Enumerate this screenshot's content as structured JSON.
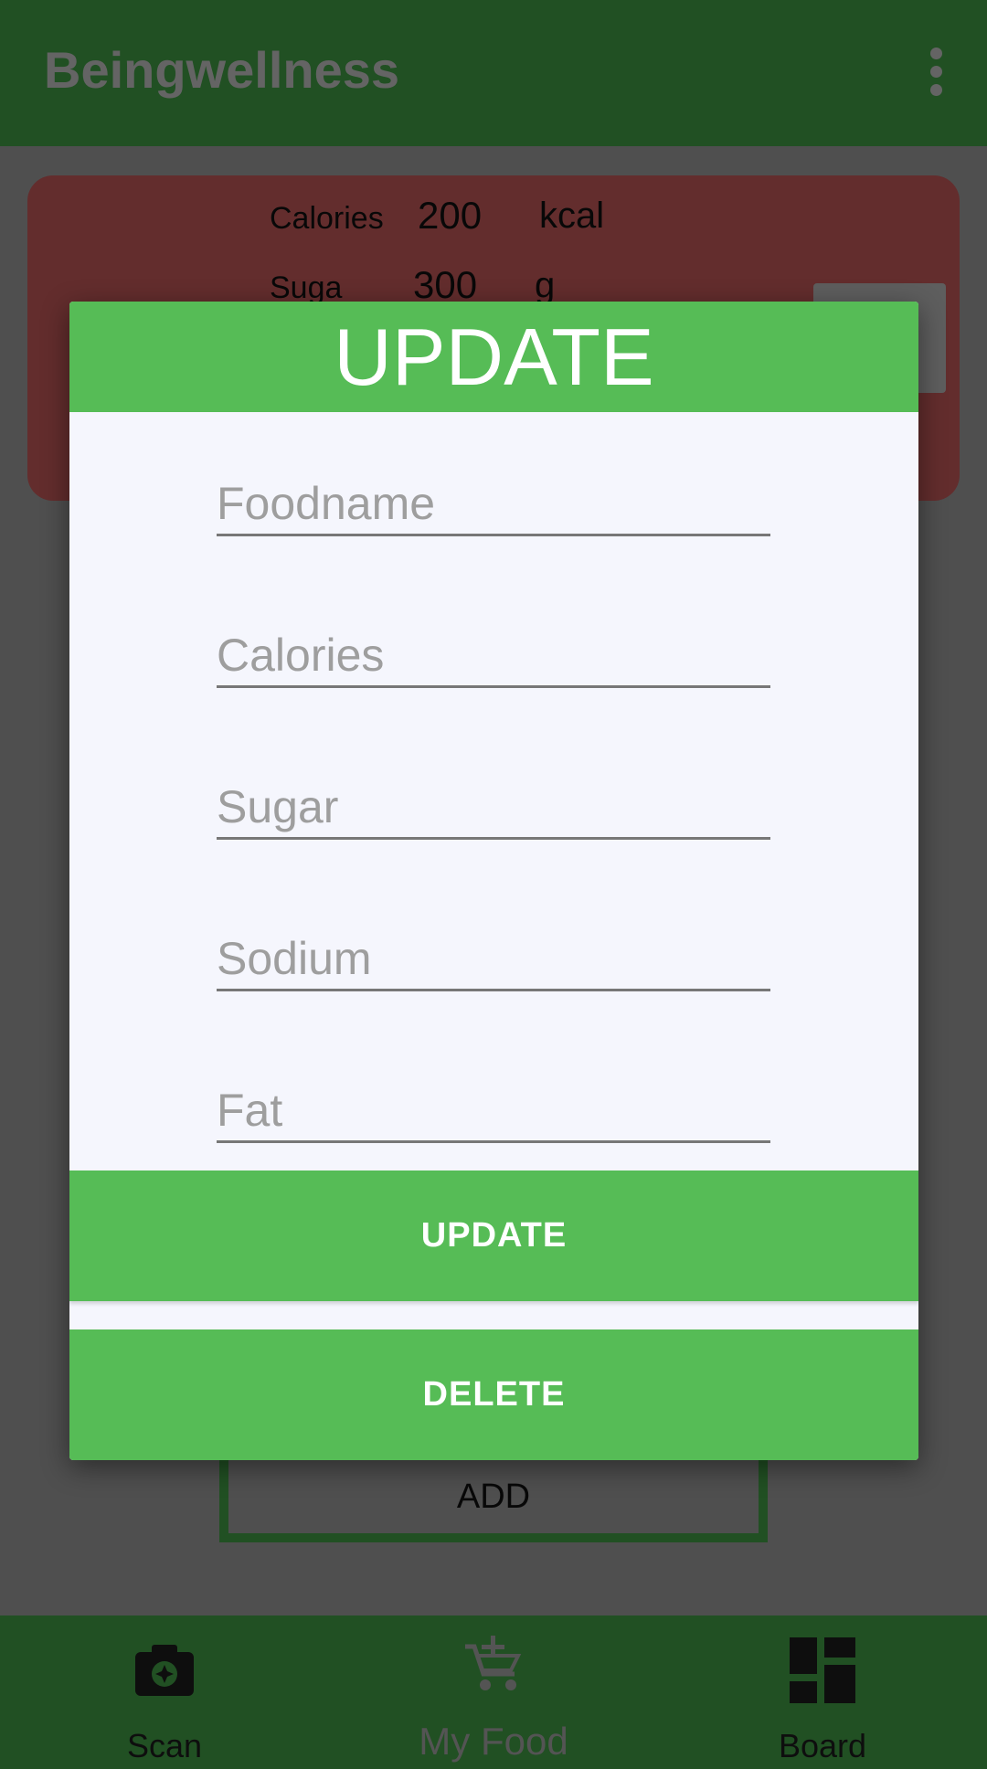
{
  "app": {
    "title": "Beingwellness"
  },
  "card": {
    "rows": [
      {
        "label": "Calories",
        "value": "200",
        "unit": "kcal"
      },
      {
        "label": "Suga",
        "value": "300",
        "unit": "g"
      }
    ]
  },
  "background": {
    "add_label": "ADD"
  },
  "dialog": {
    "title": "UPDATE",
    "fields": {
      "foodname": {
        "placeholder": "Foodname",
        "value": ""
      },
      "calories": {
        "placeholder": "Calories",
        "value": ""
      },
      "sugar": {
        "placeholder": "Sugar",
        "value": ""
      },
      "sodium": {
        "placeholder": "Sodium",
        "value": ""
      },
      "fat": {
        "placeholder": "Fat",
        "value": ""
      }
    },
    "update_label": "UPDATE",
    "delete_label": "DELETE"
  },
  "bottom_nav": {
    "items": [
      {
        "label": "Scan",
        "icon": "camera-icon"
      },
      {
        "label": "My Food",
        "icon": "add-cart-icon"
      },
      {
        "label": "Board",
        "icon": "dashboard-icon"
      }
    ],
    "active_index": 1
  },
  "colors": {
    "primary": "#43a047",
    "dialog_accent": "#56bc56",
    "card": "#c65a5a"
  }
}
